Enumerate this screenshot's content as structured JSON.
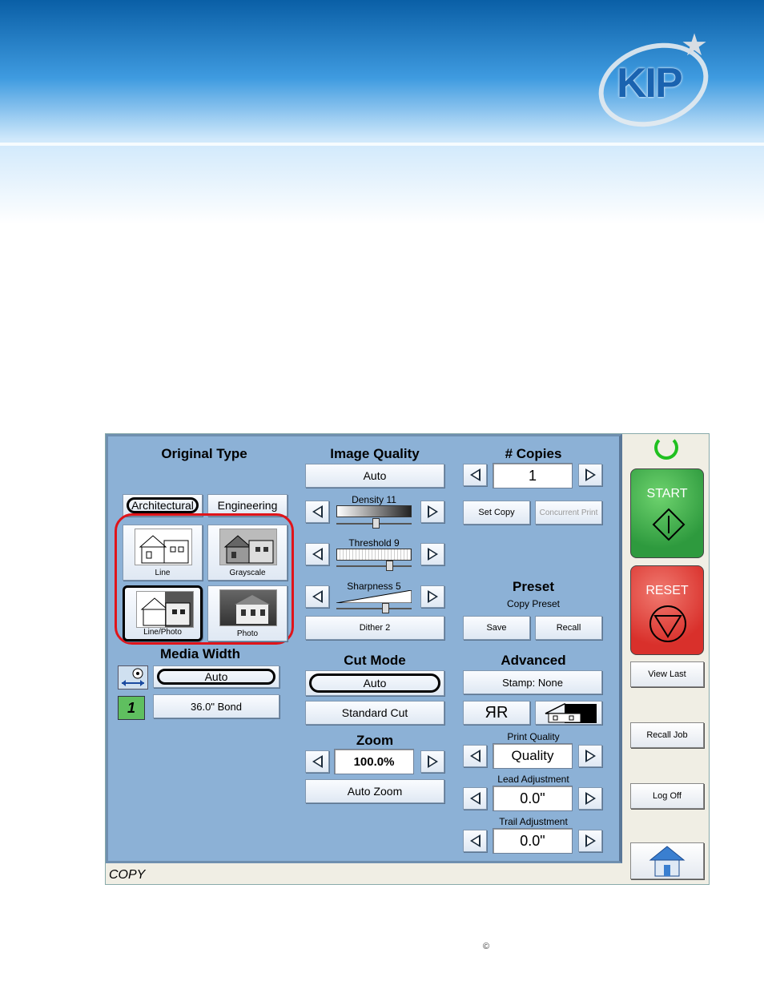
{
  "logo": {
    "text": "KIP"
  },
  "original_type": {
    "title": "Original Type",
    "tabs": [
      "Architectural",
      "Engineering"
    ],
    "modes": [
      "Line",
      "Grayscale",
      "Line/Photo",
      "Photo"
    ]
  },
  "media_width": {
    "title": "Media Width",
    "width_value": "Auto",
    "media_value": "36.0\" Bond",
    "roll_number": "1"
  },
  "image_quality": {
    "title": "Image Quality",
    "mode": "Auto",
    "density_label": "Density 11",
    "threshold_label": "Threshold 9",
    "sharpness_label": "Sharpness 5",
    "density": 11,
    "threshold": 9,
    "sharpness": 5,
    "dither": "Dither 2"
  },
  "cut_mode": {
    "title": "Cut Mode",
    "mode": "Auto",
    "option": "Standard Cut"
  },
  "zoom": {
    "title": "Zoom",
    "value": "100.0%",
    "auto": "Auto Zoom"
  },
  "copies": {
    "title": "# Copies",
    "value": "1",
    "set_copy": "Set Copy",
    "concurrent_print": "Concurrent Print"
  },
  "preset": {
    "title": "Preset",
    "subtitle": "Copy Preset",
    "save": "Save",
    "recall": "Recall"
  },
  "advanced": {
    "title": "Advanced",
    "stamp": "Stamp: None",
    "mirror_icon_text": "ЯR",
    "print_quality_label": "Print Quality",
    "print_quality": "Quality",
    "lead_label": "Lead Adjustment",
    "lead_value": "0.0\"",
    "trail_label": "Trail Adjustment",
    "trail_value": "0.0\""
  },
  "side": {
    "start": "START",
    "reset": "RESET",
    "view_last": "View Last",
    "recall_job": "Recall Job",
    "log_off": "Log Off"
  },
  "status": "COPY",
  "footer": {
    "copyright": "©"
  },
  "colors": {
    "panel": "#8cb1d6",
    "start": "#2e9a3e",
    "reset": "#d9302b",
    "highlight": "#e0141a"
  }
}
